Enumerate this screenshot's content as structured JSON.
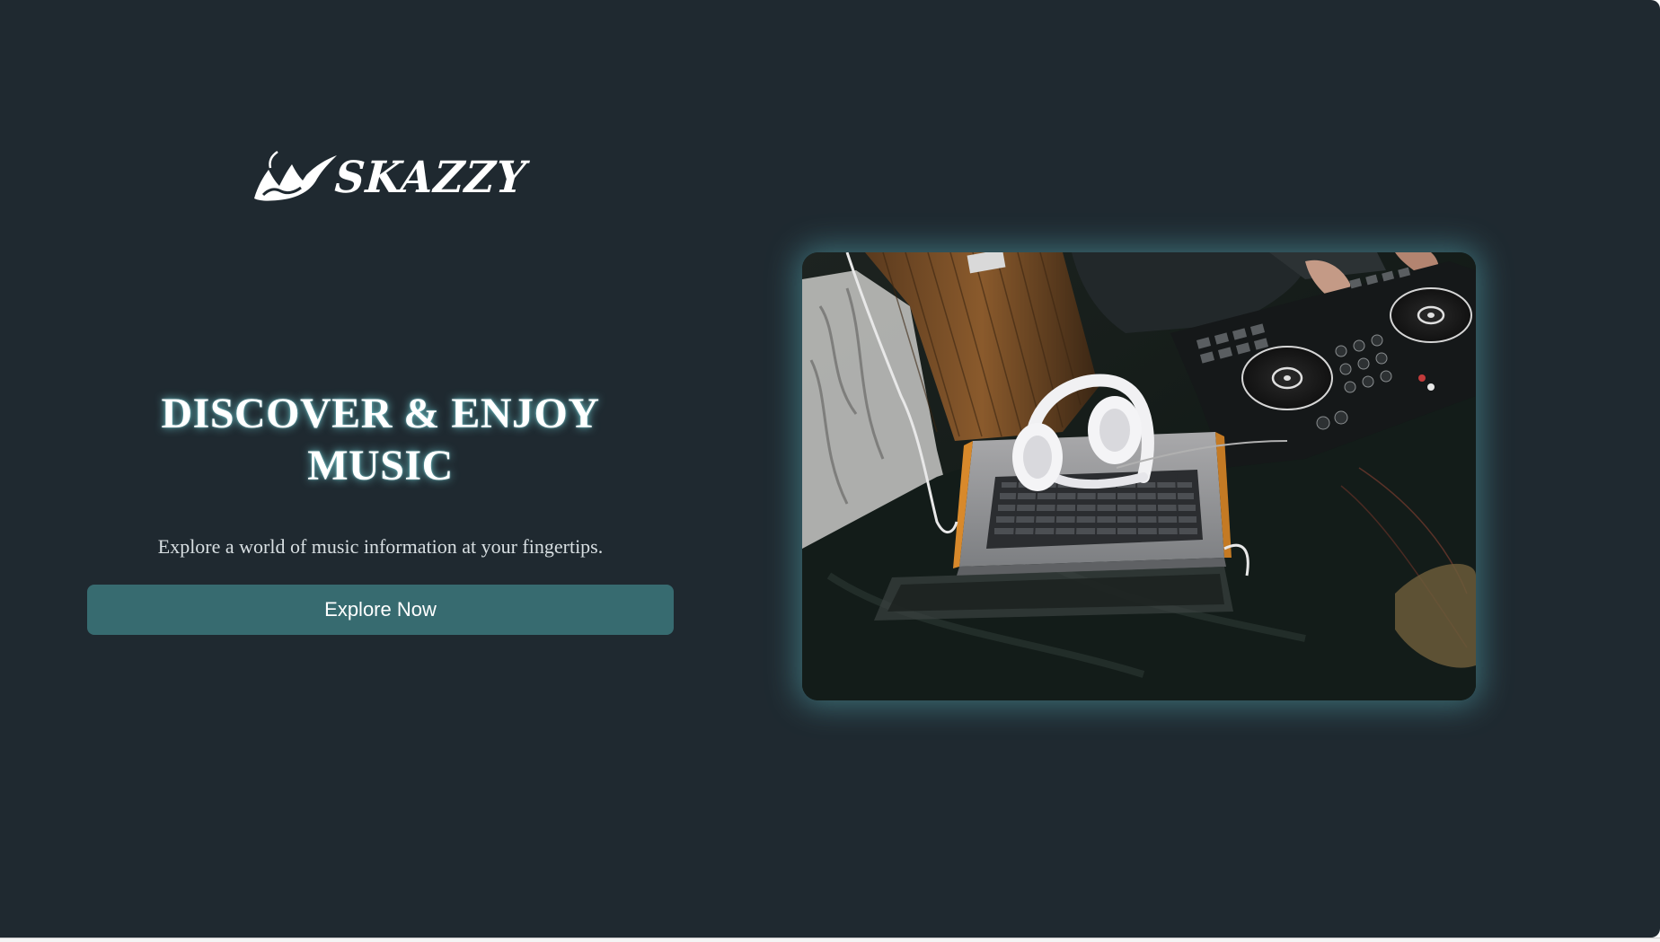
{
  "brand": {
    "name": "SKAZZY",
    "logo_icon": "mountain-brush-logo-icon"
  },
  "hero": {
    "headline_line1": "DISCOVER & ENJOY",
    "headline_line2": "MUSIC",
    "subtitle": "Explore a world of music information at your fingertips.",
    "cta_label": "Explore Now",
    "image_alt": "DJ controller with laptop and white headphones"
  },
  "colors": {
    "background": "#1f2930",
    "button": "#376b70",
    "glow": "#5fbec8",
    "text": "#ffffff"
  }
}
